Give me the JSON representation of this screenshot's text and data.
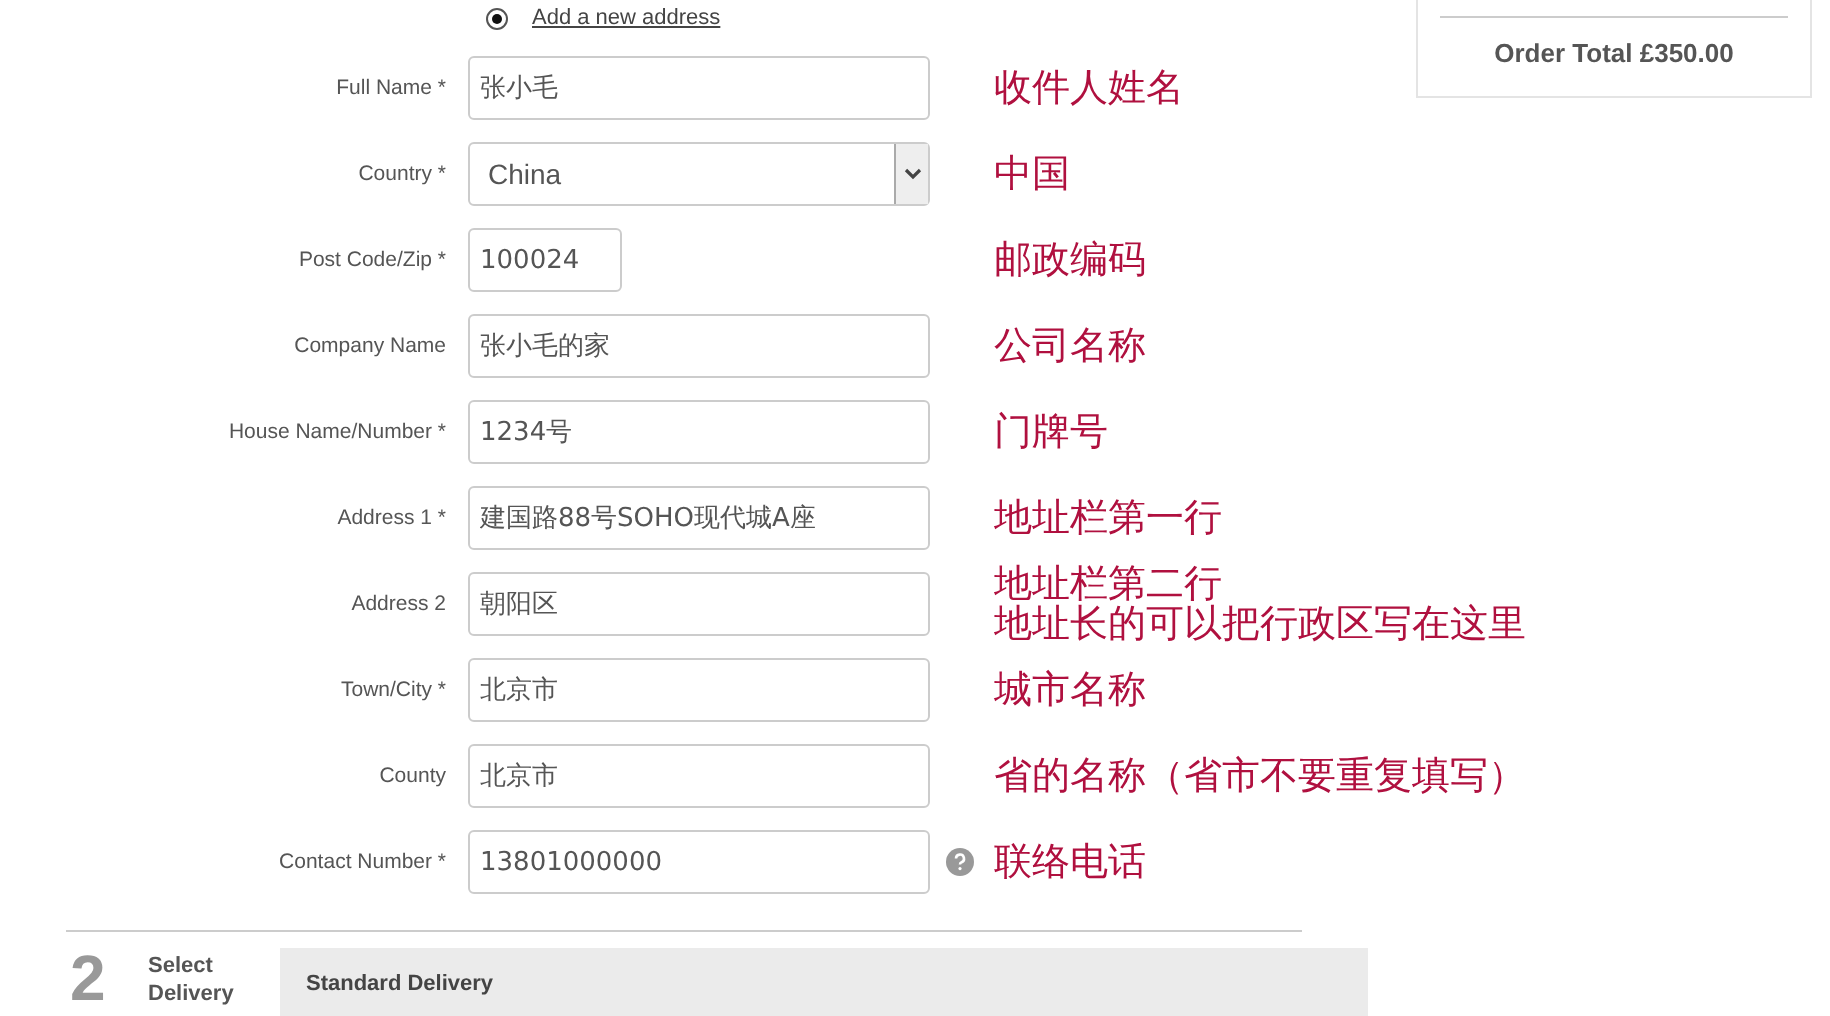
{
  "address_option": {
    "label": "Add a new address",
    "selected": true
  },
  "order_summary": {
    "total": "Order Total £350.00"
  },
  "fields": [
    {
      "label": "Full Name *",
      "kind": "input",
      "value": "张小毛",
      "annotation": [
        "收件人姓名"
      ]
    },
    {
      "label": "Country *",
      "kind": "select",
      "value": "China",
      "annotation": [
        "中国"
      ]
    },
    {
      "label": "Post Code/Zip *",
      "kind": "short",
      "value": "100024",
      "annotation": [
        "邮政编码"
      ]
    },
    {
      "label": "Company Name",
      "kind": "input",
      "value": "张小毛的家",
      "annotation": [
        "公司名称"
      ]
    },
    {
      "label": "House Name/Number *",
      "kind": "input",
      "value": "1234号",
      "annotation": [
        "门牌号"
      ]
    },
    {
      "label": "Address 1 *",
      "kind": "input",
      "value": "建国路88号SOHO现代城A座",
      "annotation": [
        "地址栏第一行"
      ]
    },
    {
      "label": "Address 2",
      "kind": "input",
      "value": "朝阳区",
      "annotation": [
        "地址栏第二行",
        "地址长的可以把行政区写在这里"
      ]
    },
    {
      "label": "Town/City *",
      "kind": "input",
      "value": "北京市",
      "annotation": [
        "城市名称"
      ]
    },
    {
      "label": "County",
      "kind": "input",
      "value": "北京市",
      "annotation": [
        "省的名称（省市不要重复填写）"
      ]
    },
    {
      "label": "Contact Number *",
      "kind": "input",
      "value": "13801000000",
      "help": true,
      "annotation": [
        "联络电话"
      ]
    }
  ],
  "step": {
    "number": "2",
    "title": "Select Delivery",
    "option": "Standard Delivery"
  }
}
